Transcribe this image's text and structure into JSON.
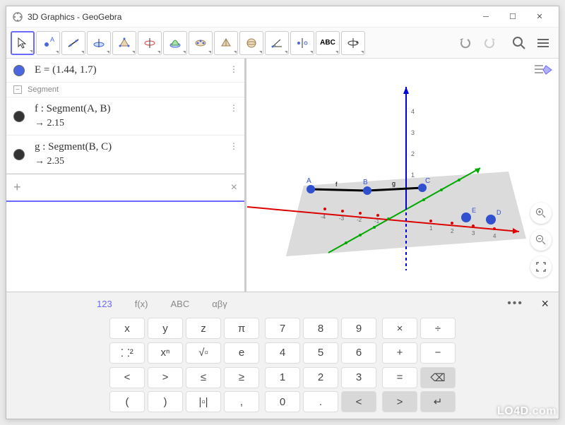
{
  "window": {
    "title": "3D Graphics - GeoGebra"
  },
  "algebra": {
    "point_E": "E = (1.44, 1.7)",
    "section": "Segment",
    "seg_f_def": "f : Segment(A, B)",
    "seg_f_val": "→  2.15",
    "seg_g_def": "g : Segment(B, C)",
    "seg_g_val": "→  2.35",
    "plus": "+",
    "clear": "×"
  },
  "kbtabs": {
    "t1": "123",
    "t2": "f(x)",
    "t3": "ABC",
    "t4": "αβγ",
    "more": "•••",
    "close": "×"
  },
  "keys": {
    "r1": [
      "x",
      "y",
      "z",
      "π",
      "7",
      "8",
      "9",
      "×",
      "÷"
    ],
    "r2": [
      "⸬²",
      "xⁿ",
      "√▫",
      "e",
      "4",
      "5",
      "6",
      "+",
      "−"
    ],
    "r3": [
      "<",
      ">",
      "≤",
      "≥",
      "1",
      "2",
      "3",
      "=",
      "⌫"
    ],
    "r4": [
      "(",
      ")",
      "|▫|",
      ",",
      "0",
      ".",
      "<",
      ">",
      "↵"
    ]
  },
  "watermark": {
    "a": "LO4D",
    "b": ".com"
  }
}
